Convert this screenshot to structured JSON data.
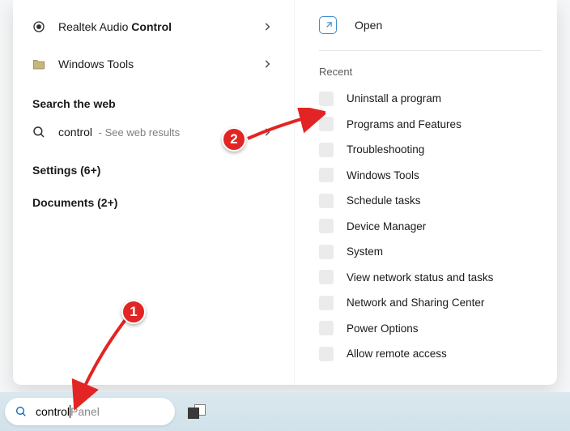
{
  "left": {
    "results": [
      {
        "icon": "audio",
        "pre": "Realtek Audio ",
        "bold": "Control",
        "post": ""
      },
      {
        "icon": "tools",
        "pre": "Windows Tools",
        "bold": "",
        "post": ""
      }
    ],
    "webHeader": "Search the web",
    "webQuery": "control",
    "webSuffix": " - See web results",
    "settings": "Settings (6+)",
    "documents": "Documents (2+)"
  },
  "right": {
    "open": "Open",
    "recentHeader": "Recent",
    "recent": [
      "Uninstall a program",
      "Programs and Features",
      "Troubleshooting",
      "Windows Tools",
      "Schedule tasks",
      "Device Manager",
      "System",
      "View network status and tasks",
      "Network and Sharing Center",
      "Power Options",
      "Allow remote access"
    ]
  },
  "taskbar": {
    "typed": "control",
    "ghost": "Panel"
  },
  "annotations": {
    "b1": "1",
    "b2": "2"
  }
}
